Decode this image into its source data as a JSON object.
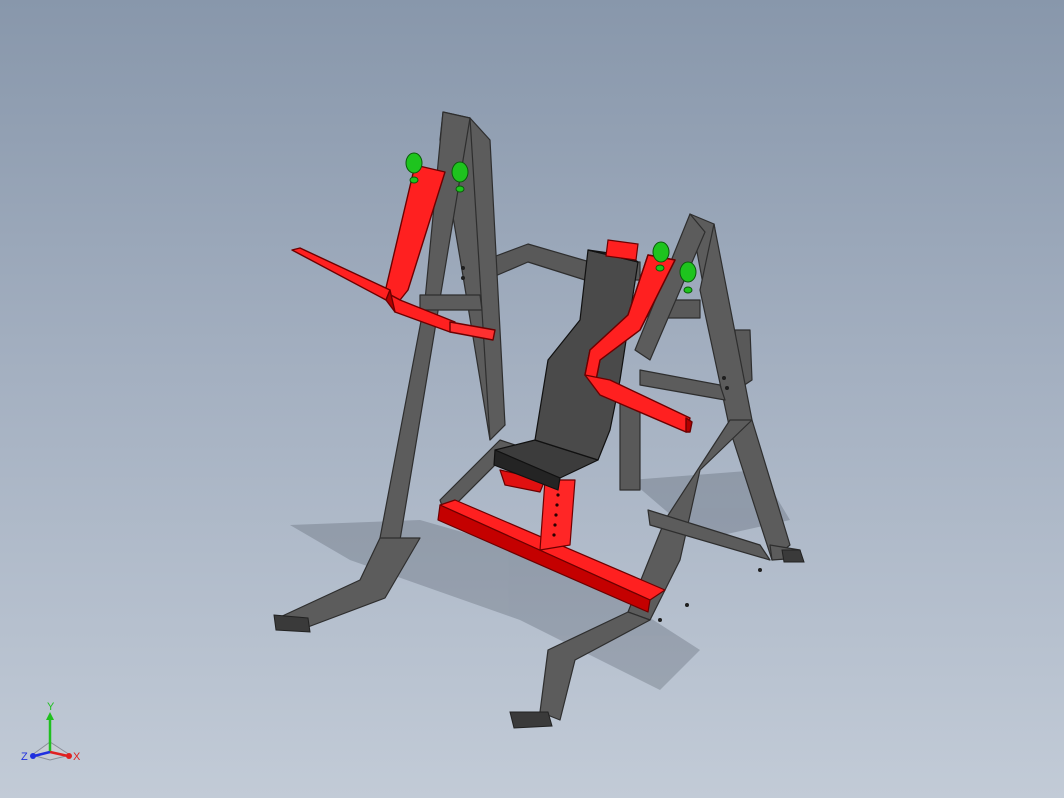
{
  "viewport": {
    "model": "machine-assembly",
    "colors": {
      "background_top": "#8897ab",
      "background_bottom": "#c2cbd7",
      "frame": "#5a5a5a",
      "frame_dark": "#3e3e3e",
      "accent": "#ff1a1a",
      "accent_dark": "#b30000",
      "pad": "#3a3a3a",
      "bearing": "#19c419"
    }
  },
  "triad": {
    "x_label": "X",
    "y_label": "Y",
    "z_label": "Z",
    "x_color": "#e02020",
    "y_color": "#20c020",
    "z_color": "#2030e0"
  }
}
